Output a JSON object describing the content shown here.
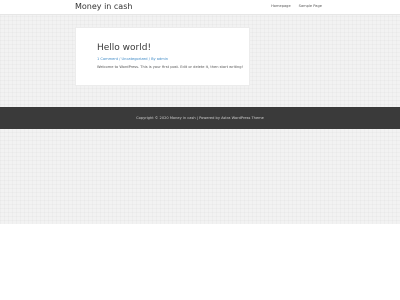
{
  "header": {
    "site_title": "Money in cash",
    "nav": [
      "Homepage",
      "Sample Page"
    ]
  },
  "post": {
    "title": "Hello world!",
    "meta": "1 Comment / Uncategorized / By admin",
    "excerpt": "Welcome to WordPress. This is your first post. Edit or delete it, then start writing!"
  },
  "footer": {
    "text": "Copyright © 2020 Money in cash | Powered by Astra WordPress Theme"
  },
  "colors": {
    "background": "#f2f2f2",
    "footer_background": "#3a3a3a",
    "link": "#3a87c5"
  }
}
